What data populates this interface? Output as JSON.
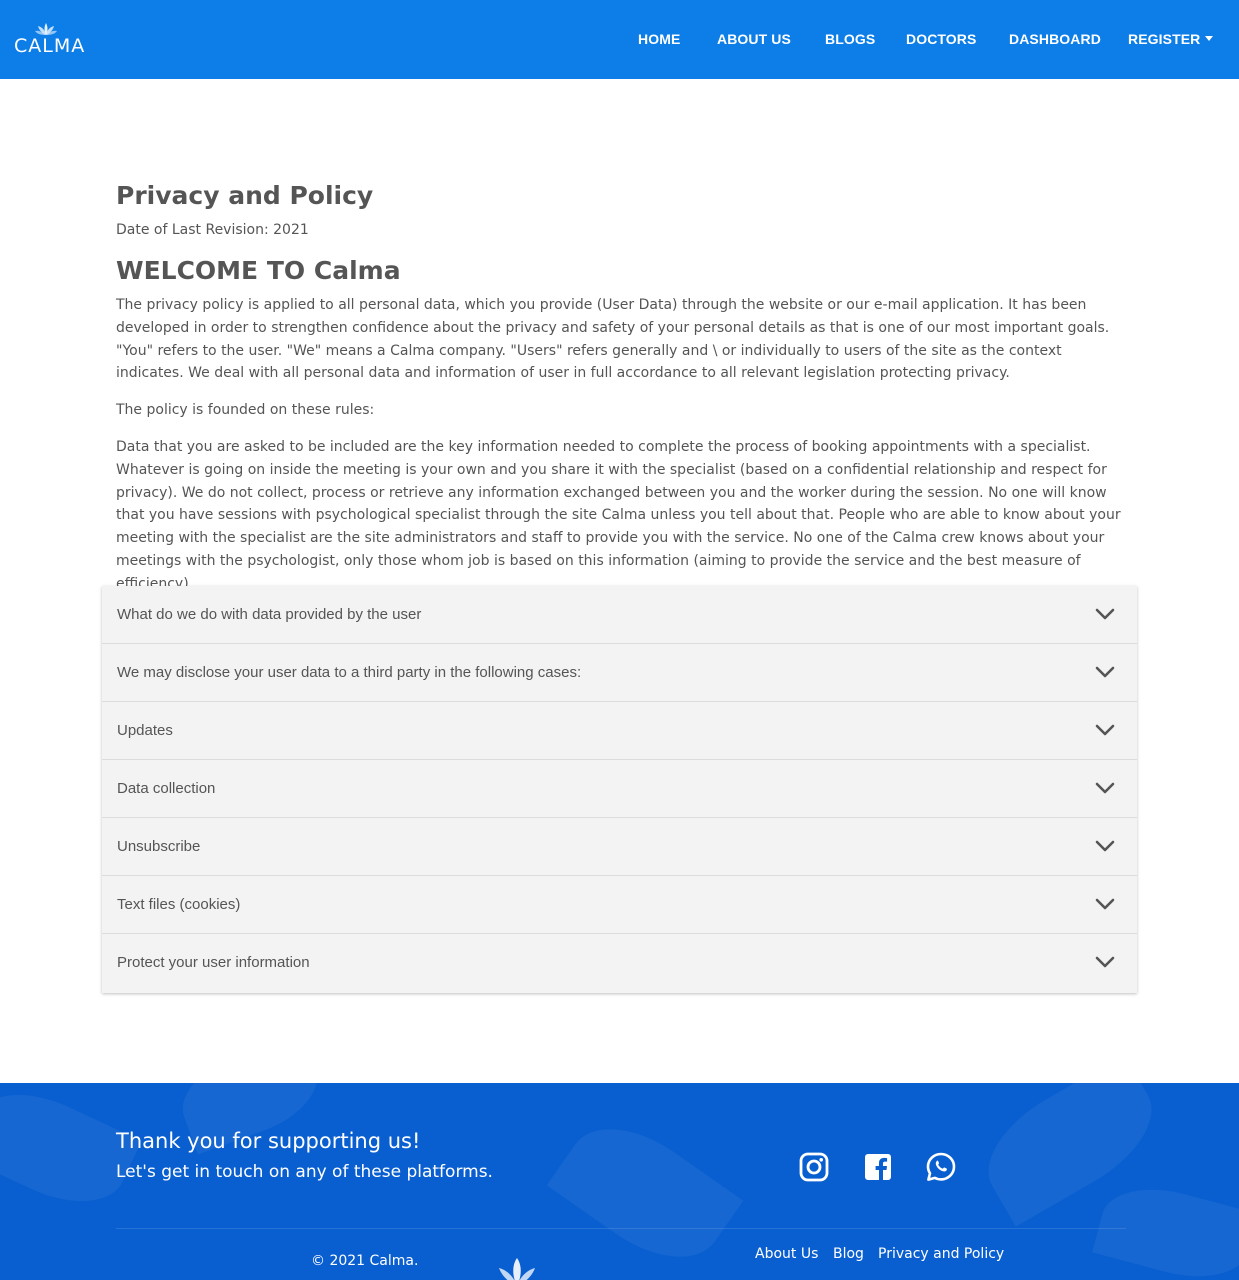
{
  "navbar": {
    "brand": "CALMA",
    "items": [
      {
        "label": "HOME"
      },
      {
        "label": "ABOUT US"
      },
      {
        "label": "BLOGS"
      },
      {
        "label": "DOCTORS"
      },
      {
        "label": "DASHBOARD"
      },
      {
        "label": "REGISTER"
      }
    ]
  },
  "content": {
    "title": "Privacy and Policy",
    "revision": "Date of Last Revision: 2021",
    "welcome": "WELCOME TO Calma",
    "paragraphs": [
      "The privacy policy is applied to all personal data, which you provide (User Data) through the website or our e-mail application. It has been developed in order to strengthen confidence about the privacy and safety of your personal details as that is one of our most important goals. \"You\" refers to the user. \"We\" means a Calma company. \"Users\" refers generally and \\ or individually to users of the site as the context indicates. We deal with all personal data and information of user in full accordance to all relevant legislation protecting privacy.",
      "The policy is founded on these rules:",
      "Data that you are asked to be included are the key information needed to complete the process of booking appointments with a specialist. Whatever is going on inside the meeting is your own and you share it with the specialist (based on a confidential relationship and respect for privacy). We do not collect, process or retrieve any information exchanged between you and the worker during the session. No one will know that you have sessions with psychological specialist through the site Calma unless you tell about that. People who are able to know about your meeting with the specialist are the site administrators and staff to provide you with the service. No one of the Calma crew knows about your meetings with the psychologist, only those whom job is based on this information (aiming to provide the service and the best measure of efficiency)"
    ]
  },
  "accordion": {
    "items": [
      {
        "label": "What do we do with data provided by the user"
      },
      {
        "label": "We may disclose your user data to a third party in the following cases:"
      },
      {
        "label": "Updates"
      },
      {
        "label": "Data collection"
      },
      {
        "label": "Unsubscribe"
      },
      {
        "label": "Text files (cookies)"
      },
      {
        "label": "Protect your user information"
      }
    ]
  },
  "footer": {
    "thanks": "Thank you for supporting us!",
    "touch": "Let's get in touch on any of these platforms.",
    "social_icons": [
      "instagram-icon",
      "facebook-icon",
      "whatsapp-icon"
    ],
    "copyright": "© 2021 Calma.",
    "links": [
      {
        "label": "About Us"
      },
      {
        "label": "Blog"
      },
      {
        "label": "Privacy and Policy"
      }
    ]
  },
  "colors": {
    "primary": "#0d7ee8",
    "footer": "#0a5fd0",
    "accordion_bg": "#f3f3f3",
    "text": "#555555"
  }
}
